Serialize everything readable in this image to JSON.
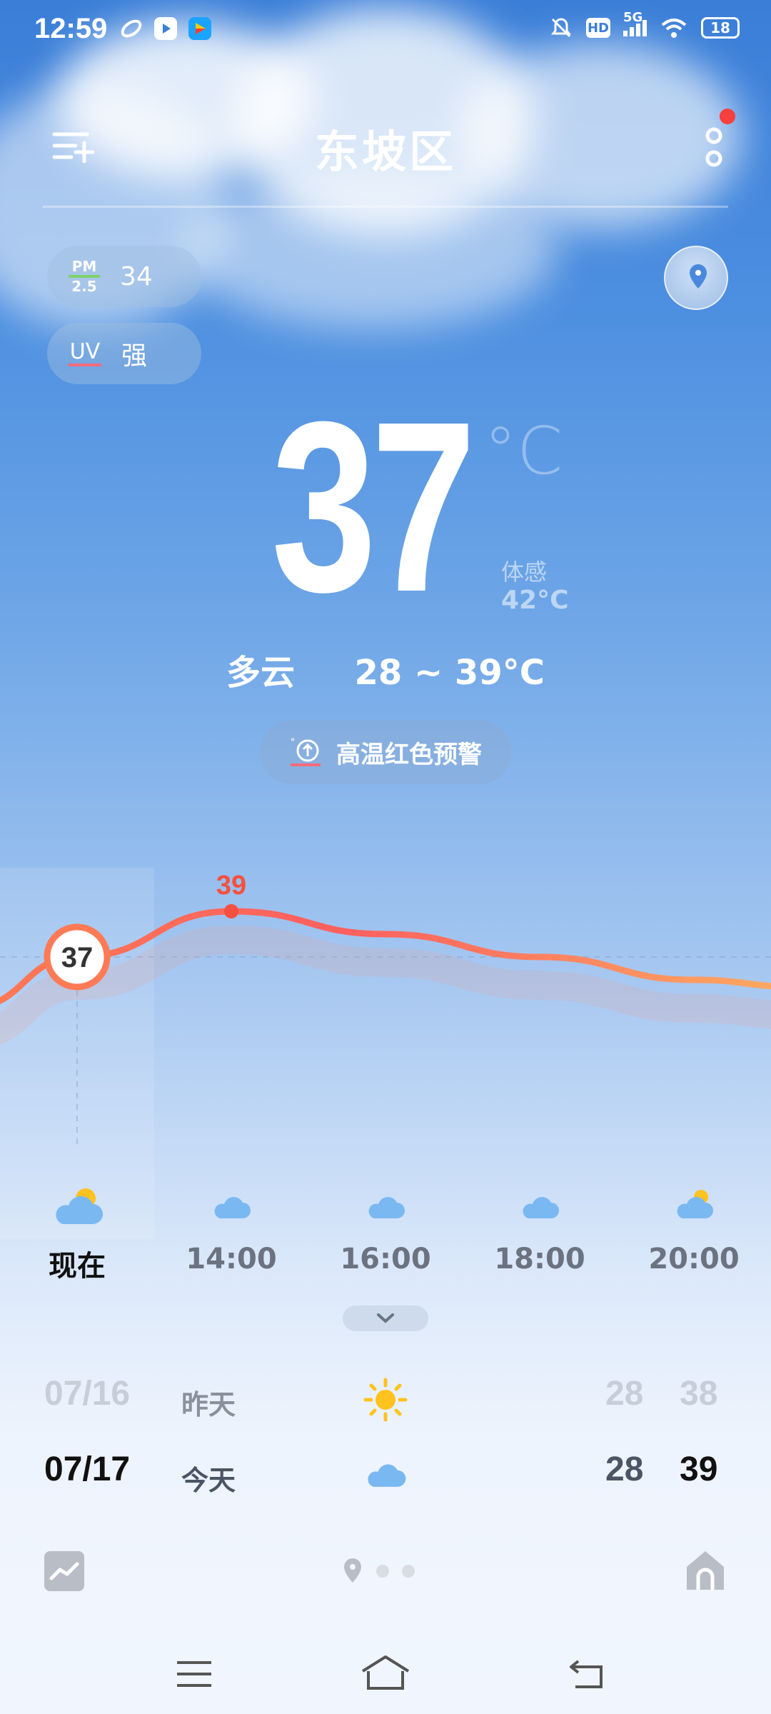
{
  "status_bar": {
    "time": "12:59",
    "network": "5G",
    "hd_label": "HD",
    "battery": "18"
  },
  "header": {
    "city": "东坡区"
  },
  "air": {
    "pm_label_top": "PM",
    "pm_label_bottom": "2.5",
    "pm_value": "34",
    "uv_label": "UV",
    "uv_value": "强"
  },
  "current": {
    "temperature": "37",
    "unit": "°C",
    "feels_label": "体感",
    "feels_value": "42°C",
    "condition": "多云",
    "range": "28 ~ 39°C"
  },
  "alert": {
    "text": "高温红色预警"
  },
  "hourly": {
    "chart_data": {
      "type": "line",
      "x": [
        "现在",
        "14:00",
        "16:00",
        "18:00",
        "20:00"
      ],
      "values": [
        37,
        39,
        38,
        37,
        36
      ],
      "labels_shown": {
        "now": "37",
        "peak": "39"
      }
    },
    "items": [
      {
        "label": "现在",
        "icon": "partly-cloudy-icon"
      },
      {
        "label": "14:00",
        "icon": "cloud-icon"
      },
      {
        "label": "16:00",
        "icon": "cloud-icon"
      },
      {
        "label": "18:00",
        "icon": "cloud-icon"
      },
      {
        "label": "20:00",
        "icon": "partly-cloudy-icon"
      }
    ]
  },
  "daily": [
    {
      "date": "07/16",
      "name": "昨天",
      "icon": "sun-icon",
      "low": "28",
      "high": "38"
    },
    {
      "date": "07/17",
      "name": "今天",
      "icon": "cloud-icon",
      "low": "28",
      "high": "39"
    }
  ],
  "colors": {
    "curve_start": "#ff6b5e",
    "curve_end": "#ffa65c",
    "accent_red": "#f5403d"
  }
}
